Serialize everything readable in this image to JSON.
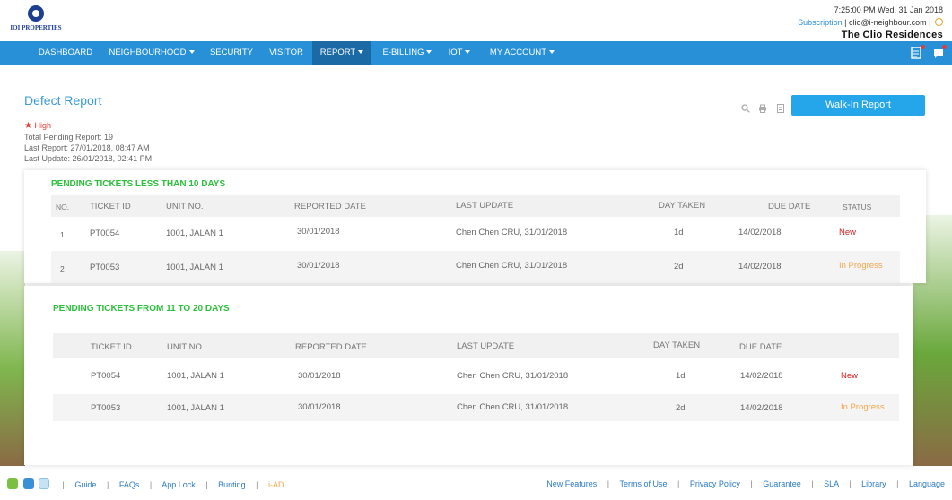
{
  "header": {
    "logo_text": "IOI PROPERTIES",
    "datetime": "7:25:00 PM  Wed, 31 Jan 2018",
    "subscription_label": "Subscription",
    "user_email": "clio@i-neighbour.com",
    "site_name": "The Clio Residences"
  },
  "nav": {
    "items": [
      {
        "label": "DASHBOARD"
      },
      {
        "label": "NEIGHBOURHOOD"
      },
      {
        "label": "SECURITY"
      },
      {
        "label": "VISITOR"
      },
      {
        "label": "REPORT"
      },
      {
        "label": "E-BILLING"
      },
      {
        "label": "IOT"
      },
      {
        "label": "MY ACCOUNT"
      }
    ],
    "active": "REPORT"
  },
  "page": {
    "title": "Defect Report",
    "priority": "High",
    "total_pending": "Total Pending Report: 19",
    "last_report": "Last Report: 27/01/2018, 08:47 AM",
    "last_update": "Last Update: 26/01/2018, 02:41 PM",
    "walkin_button": "Walk-In Report"
  },
  "section1": {
    "title": "PENDING TICKETS LESS THAN 10 DAYS",
    "headers": [
      "NO.",
      "TICKET ID",
      "UNIT NO.",
      "REPORTED DATE",
      "LAST UPDATE",
      "DAY TAKEN",
      "DUE DATE",
      "STATUS"
    ],
    "rows": [
      {
        "no": "1",
        "ticket": "PT0054",
        "unit": "1001, JALAN 1",
        "reported": "30/01/2018",
        "last_update": "Chen Chen CRU, 31/01/2018",
        "days": "1d",
        "due": "14/02/2018",
        "status": "New"
      },
      {
        "no": "2",
        "ticket": "PT0053",
        "unit": "1001, JALAN 1",
        "reported": "30/01/2018",
        "last_update": "Chen Chen CRU, 31/01/2018",
        "days": "2d",
        "due": "14/02/2018",
        "status": "In Progress"
      }
    ]
  },
  "section2": {
    "title": "PENDING TICKETS FROM 11 TO 20 DAYS",
    "headers": [
      "TICKET ID",
      "UNIT NO.",
      "REPORTED DATE",
      "LAST UPDATE",
      "DAY TAKEN",
      "DUE DATE"
    ],
    "rows": [
      {
        "ticket": "PT0054",
        "unit": "1001, JALAN 1",
        "reported": "30/01/2018",
        "last_update": "Chen Chen CRU, 31/01/2018",
        "days": "1d",
        "due": "14/02/2018",
        "status": "New"
      },
      {
        "ticket": "PT0053",
        "unit": "1001, JALAN 1",
        "reported": "30/01/2018",
        "last_update": "Chen Chen CRU, 31/01/2018",
        "days": "2d",
        "due": "14/02/2018",
        "status": "In Progress"
      }
    ]
  },
  "footer": {
    "left_links": [
      "Guide",
      "FAQs",
      "App Lock",
      "Bunting",
      "i-AD"
    ],
    "right_links": [
      "New Features",
      "Terms of Use",
      "Privacy Policy",
      "Guarantee",
      "SLA",
      "Library",
      "Language"
    ]
  },
  "colors": {
    "nav_bg": "#2790d6",
    "nav_active": "#1b6aa6",
    "accent_blue": "#3a9bd9",
    "section_green": "#2bbf3b",
    "status_new": "#e02020",
    "status_progress": "#f4a64a"
  }
}
